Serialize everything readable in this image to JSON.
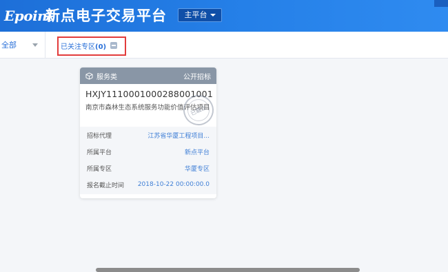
{
  "header": {
    "logo_text": "Epoint",
    "title": "新点电子交易平台",
    "platform_button": "主平台"
  },
  "toolbar": {
    "scope_select_value": "全部",
    "follow_label": "已关注专区",
    "follow_count": "(0)"
  },
  "card": {
    "category": "服务类",
    "type": "公开招标",
    "code": "HXJY1110001000288001001",
    "name": "南京市森林生态系统服务功能价值评估项目",
    "stamp_text": "已截止",
    "details": [
      {
        "label": "招标代理",
        "value": "江苏省华厦工程项目..."
      },
      {
        "label": "所属平台",
        "value": "新点平台"
      },
      {
        "label": "所属专区",
        "value": "华厦专区"
      },
      {
        "label": "报名截止时间",
        "value": "2018-10-22 00:00:00.0"
      }
    ]
  },
  "icons": {
    "logo": "epoint-logo",
    "platform_dropdown": "caret-down-icon",
    "scope_dropdown": "caret-down-icon",
    "follow_close": "close-tag-icon",
    "category": "cube-icon",
    "stamp": "expired-stamp"
  },
  "colors": {
    "header": "#2580e8",
    "accent": "#2a70d8",
    "highlight_border": "#e23b3b",
    "card_head": "#8996a6"
  }
}
